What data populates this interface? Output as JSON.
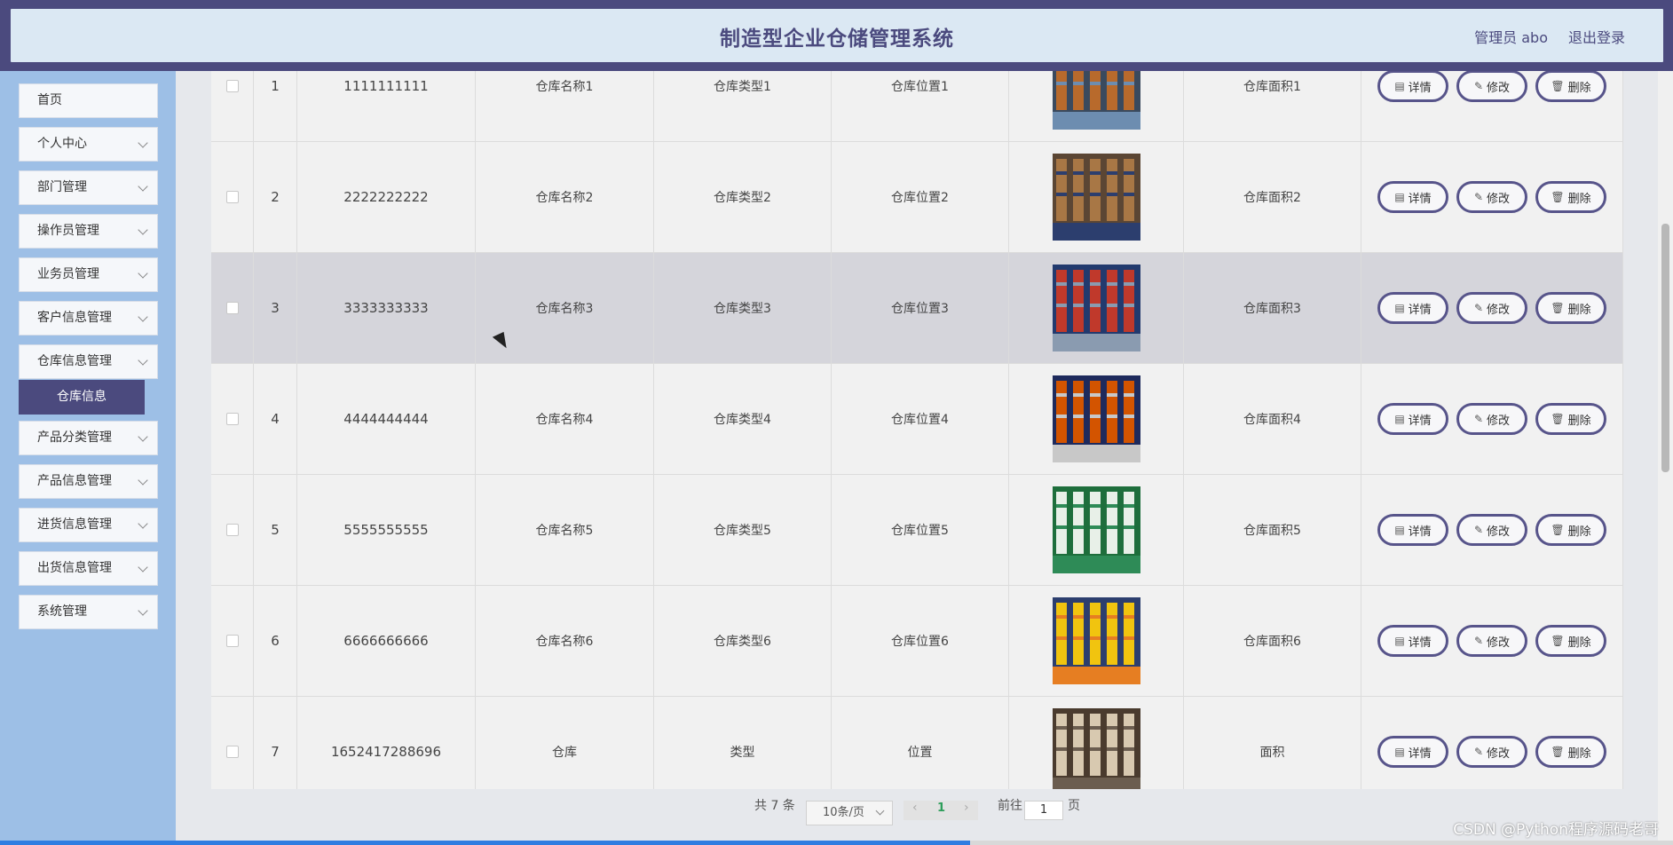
{
  "header": {
    "title": "制造型企业仓储管理系统",
    "user": "管理员 abo",
    "logout": "退出登录"
  },
  "sidebar": {
    "items": [
      {
        "label": "首页",
        "has_chevron": false
      },
      {
        "label": "个人中心",
        "has_chevron": true
      },
      {
        "label": "部门管理",
        "has_chevron": true
      },
      {
        "label": "操作员管理",
        "has_chevron": true
      },
      {
        "label": "业务员管理",
        "has_chevron": true
      },
      {
        "label": "客户信息管理",
        "has_chevron": true
      },
      {
        "label": "仓库信息管理",
        "has_chevron": true
      },
      {
        "label": "产品分类管理",
        "has_chevron": true
      },
      {
        "label": "产品信息管理",
        "has_chevron": true
      },
      {
        "label": "进货信息管理",
        "has_chevron": true
      },
      {
        "label": "出货信息管理",
        "has_chevron": true
      },
      {
        "label": "系统管理",
        "has_chevron": true
      }
    ],
    "active_sub": "仓库信息"
  },
  "table": {
    "rows": [
      {
        "idx": "1",
        "code": "1111111111",
        "name": "仓库名称1",
        "type": "仓库类型1",
        "location": "仓库位置1",
        "area": "仓库面积1",
        "img_colors": [
          "#3a4a5e",
          "#b86a2c",
          "#6d8db0"
        ]
      },
      {
        "idx": "2",
        "code": "2222222222",
        "name": "仓库名称2",
        "type": "仓库类型2",
        "location": "仓库位置2",
        "area": "仓库面积2",
        "img_colors": [
          "#5b4634",
          "#a87745",
          "#2c3e6e"
        ]
      },
      {
        "idx": "3",
        "code": "3333333333",
        "name": "仓库名称3",
        "type": "仓库类型3",
        "location": "仓库位置3",
        "area": "仓库面积3",
        "img_colors": [
          "#223a6e",
          "#c0392b",
          "#8a9bb0"
        ]
      },
      {
        "idx": "4",
        "code": "4444444444",
        "name": "仓库名称4",
        "type": "仓库类型4",
        "location": "仓库位置4",
        "area": "仓库面积4",
        "img_colors": [
          "#1e2a5c",
          "#d35400",
          "#c8c8c8"
        ]
      },
      {
        "idx": "5",
        "code": "5555555555",
        "name": "仓库名称5",
        "type": "仓库类型5",
        "location": "仓库位置5",
        "area": "仓库面积5",
        "img_colors": [
          "#1e6e3c",
          "#e8f0e8",
          "#2e8b57"
        ]
      },
      {
        "idx": "6",
        "code": "6666666666",
        "name": "仓库名称6",
        "type": "仓库类型6",
        "location": "仓库位置6",
        "area": "仓库面积6",
        "img_colors": [
          "#2c3e6e",
          "#f1c40f",
          "#e67e22"
        ]
      },
      {
        "idx": "7",
        "code": "1652417288696",
        "name": "仓库",
        "type": "类型",
        "location": "位置",
        "area": "面积",
        "img_colors": [
          "#4a3b2e",
          "#d8c9b0",
          "#6b5d4f"
        ]
      }
    ],
    "hover_row": 2,
    "actions": {
      "detail": "详情",
      "edit": "修改",
      "delete": "删除"
    }
  },
  "pagination": {
    "total": "共 7 条",
    "page_size": "10条/页",
    "current_page": "1",
    "goto_prefix": "前往",
    "goto_value": "1",
    "goto_suffix": "页"
  },
  "watermark": "CSDN @Python程序源码老哥",
  "progress_fraction": 0.58
}
